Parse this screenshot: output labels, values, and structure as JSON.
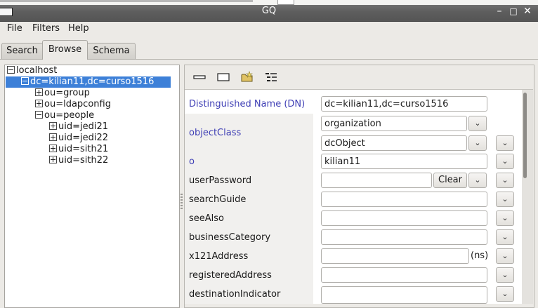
{
  "window": {
    "title": "GQ",
    "controls": {
      "minimize": "–",
      "maximize": "□",
      "close": "✕"
    }
  },
  "menu": {
    "file": "File",
    "filters": "Filters",
    "help": "Help"
  },
  "tabs": [
    {
      "label": "Search",
      "active": false
    },
    {
      "label": "Browse",
      "active": true
    },
    {
      "label": "Schema",
      "active": false
    }
  ],
  "tree": {
    "root": "localhost",
    "selected": "dc=kilian11,dc=curso1516",
    "ou_group": "ou=group",
    "ou_ldapconfig": "ou=ldapconfig",
    "ou_people": "ou=people",
    "uid_jedi21": "uid=jedi21",
    "uid_jedi22": "uid=jedi22",
    "uid_sith21": "uid=sith21",
    "uid_sith22": "uid=sith22"
  },
  "toolbar": {
    "icons": [
      "dash-icon",
      "rectangle-icon",
      "new-folder-icon",
      "list-icon"
    ]
  },
  "form": {
    "dn_label": "Distinguished Name (DN)",
    "dn_value": "dc=kilian11,dc=curso1516",
    "objectclass_label": "objectClass",
    "objectclass_values": [
      "organization",
      "dcObject"
    ],
    "o_label": "o",
    "o_value": "kilian11",
    "userpassword_label": "userPassword",
    "userpassword_value": "",
    "clear_label": "Clear",
    "searchguide_label": "searchGuide",
    "seealso_label": "seeAlso",
    "businesscategory_label": "businessCategory",
    "x121address_label": "x121Address",
    "x121_suffix": "(ns)",
    "registeredaddress_label": "registeredAddress",
    "destinationindicator_label": "destinationIndicator",
    "required_color": "#3f3fb5"
  }
}
